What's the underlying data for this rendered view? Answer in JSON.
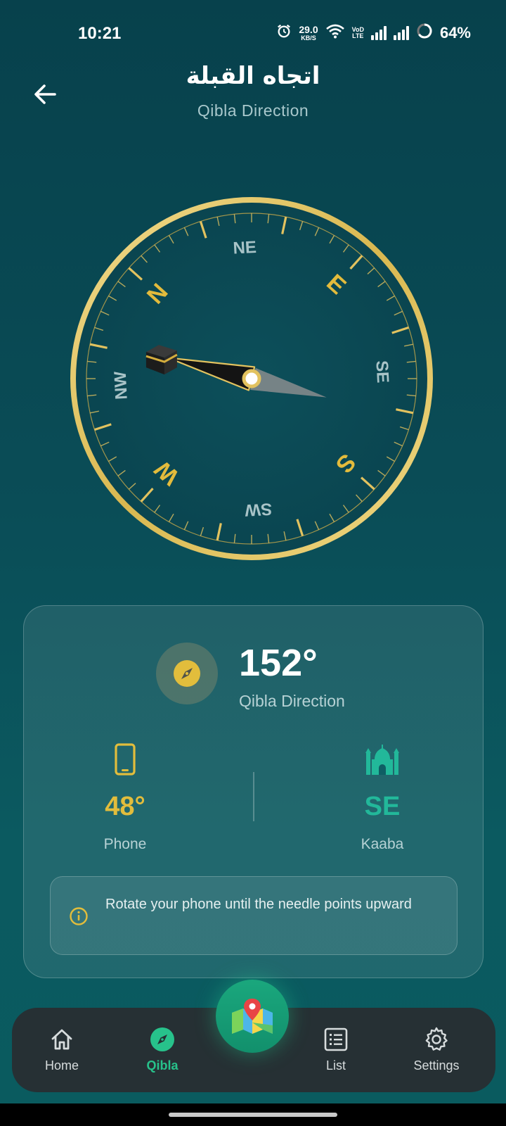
{
  "status_bar": {
    "time": "10:21",
    "net_speed_value": "29.0",
    "net_speed_unit": "KB/S",
    "volte_top": "VoD",
    "volte_bottom": "LTE",
    "battery": "64%"
  },
  "header": {
    "title_ar": "اتجاه القبلة",
    "title_en": "Qibla Direction"
  },
  "compass": {
    "labels": [
      "N",
      "NE",
      "E",
      "SE",
      "S",
      "SW",
      "W",
      "NW"
    ],
    "phone_heading_deg": 48,
    "qibla_bearing_deg": 152,
    "colors": {
      "gold": "#e2c25f",
      "ring": "#e9cf73",
      "face": "#0c4a55",
      "cardinal_gold": "#e3bb3c",
      "intercardinal": "#a8c3c7"
    }
  },
  "info": {
    "degree": "152°",
    "degree_label": "Qibla Direction",
    "phone_value": "48°",
    "phone_label": "Phone",
    "kaaba_value": "SE",
    "kaaba_label": "Kaaba",
    "hint": "Rotate your phone until the needle points upward",
    "colors": {
      "phone": "#e2bd3c",
      "kaaba": "#22b89a"
    }
  },
  "nav": {
    "items": [
      {
        "label": "Home",
        "icon": "home-icon"
      },
      {
        "label": "Qibla",
        "icon": "compass-icon",
        "active": true
      },
      {
        "label": "List",
        "icon": "list-icon"
      },
      {
        "label": "Settings",
        "icon": "gear-icon"
      }
    ],
    "fab_icon": "map-pin-icon",
    "accent": "#27c28b"
  }
}
